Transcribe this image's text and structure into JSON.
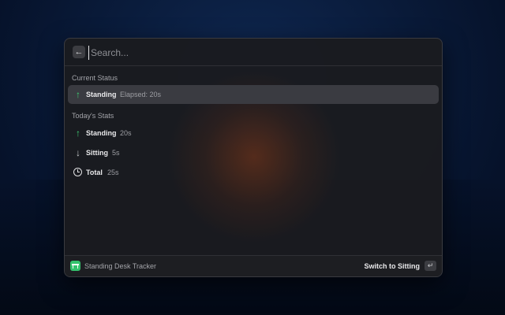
{
  "search": {
    "placeholder": "Search...",
    "back_icon": "arrow-left-icon",
    "back_glyph": "←"
  },
  "sections": {
    "current_title": "Current Status",
    "today_title": "Today's Stats"
  },
  "current_status": {
    "icon": "arrow-up-icon",
    "icon_glyph": "↑",
    "label": "Standing",
    "value": "Elapsed: 20s"
  },
  "stats": [
    {
      "icon": "arrow-up-icon",
      "icon_glyph": "↑",
      "label": "Standing",
      "value": "20s"
    },
    {
      "icon": "arrow-down-icon",
      "icon_glyph": "↓",
      "label": "Sitting",
      "value": "5s"
    },
    {
      "icon": "clock-icon",
      "label": "Total",
      "value": "25s"
    }
  ],
  "footer": {
    "app_icon": "desk-icon",
    "app_name": "Standing Desk Tracker",
    "action_label": "Switch to Sitting",
    "enter_icon": "return-key-icon",
    "enter_glyph": "↵"
  },
  "colors": {
    "accent_green": "#34c26d",
    "selected_row": "#3a3b41"
  }
}
